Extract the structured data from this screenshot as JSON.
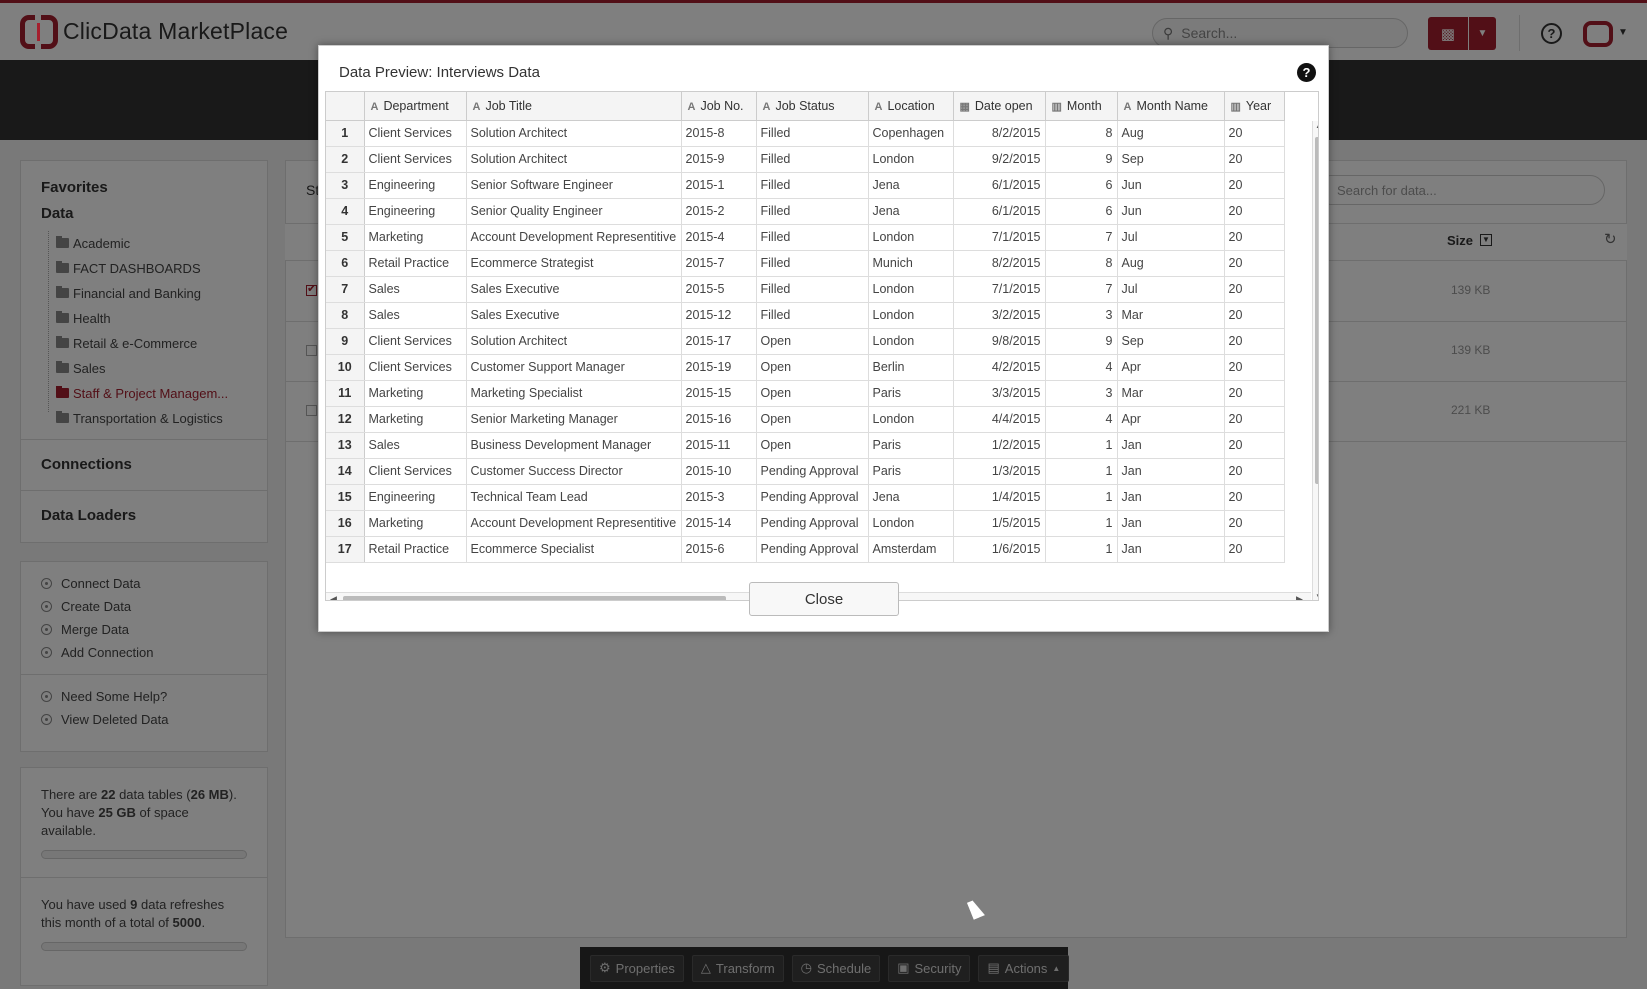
{
  "app": {
    "title": "ClicData MarketPlace",
    "search_placeholder": "Search..."
  },
  "sidebar": {
    "favorites": "Favorites",
    "data": "Data",
    "folders": [
      "Academic",
      "FACT DASHBOARDS",
      "Financial and Banking",
      "Health",
      "Retail & e-Commerce",
      "Sales",
      "Staff & Project Managem...",
      "Transportation & Logistics"
    ],
    "active_folder_index": 6,
    "connections": "Connections",
    "data_loaders": "Data Loaders",
    "actions": [
      "Connect Data",
      "Create Data",
      "Merge Data",
      "Add Connection"
    ],
    "help": [
      "Need Some Help?",
      "View Deleted Data"
    ],
    "storage": {
      "t1": "There are ",
      "tables": "22",
      "t2": " data tables (",
      "size": "26 MB",
      "t3": "). You have ",
      "space": "25 GB",
      "t4": " of space available."
    },
    "refreshes": {
      "t1": "You have used ",
      "used": "9",
      "t2": " data refreshes this month of a total of ",
      "total": "5000",
      "t3": "."
    }
  },
  "main": {
    "label": "St",
    "search_placeholder": "Search for data...",
    "size_header": "Size",
    "rows": [
      {
        "size": "139 KB",
        "checked": true
      },
      {
        "size": "139 KB",
        "checked": false
      },
      {
        "size": "221 KB",
        "checked": false
      }
    ]
  },
  "toolbar": {
    "properties": "Properties",
    "transform": "Transform",
    "schedule": "Schedule",
    "security": "Security",
    "actions": "Actions"
  },
  "modal": {
    "title": "Data Preview: Interviews Data",
    "close": "Close",
    "columns": [
      {
        "name": "Department",
        "type": "A"
      },
      {
        "name": "Job Title",
        "type": "A"
      },
      {
        "name": "Job No.",
        "type": "A"
      },
      {
        "name": "Job Status",
        "type": "A"
      },
      {
        "name": "Location",
        "type": "A"
      },
      {
        "name": "Date open",
        "type": "date"
      },
      {
        "name": "Month",
        "type": "num"
      },
      {
        "name": "Month Name",
        "type": "A"
      },
      {
        "name": "Year",
        "type": "num"
      }
    ],
    "rows": [
      [
        "1",
        "Client Services",
        "Solution Architect",
        "2015-8",
        "Filled",
        "Copenhagen",
        "8/2/2015",
        "8",
        "Aug",
        "20"
      ],
      [
        "2",
        "Client Services",
        "Solution Architect",
        "2015-9",
        "Filled",
        "London",
        "9/2/2015",
        "9",
        "Sep",
        "20"
      ],
      [
        "3",
        "Engineering",
        "Senior Software Engineer",
        "2015-1",
        "Filled",
        "Jena",
        "6/1/2015",
        "6",
        "Jun",
        "20"
      ],
      [
        "4",
        "Engineering",
        "Senior Quality Engineer",
        "2015-2",
        "Filled",
        "Jena",
        "6/1/2015",
        "6",
        "Jun",
        "20"
      ],
      [
        "5",
        "Marketing",
        "Account Development Representitive",
        "2015-4",
        "Filled",
        "London",
        "7/1/2015",
        "7",
        "Jul",
        "20"
      ],
      [
        "6",
        "Retail Practice",
        "Ecommerce Strategist",
        "2015-7",
        "Filled",
        "Munich",
        "8/2/2015",
        "8",
        "Aug",
        "20"
      ],
      [
        "7",
        "Sales",
        "Sales Executive",
        "2015-5",
        "Filled",
        "London",
        "7/1/2015",
        "7",
        "Jul",
        "20"
      ],
      [
        "8",
        "Sales",
        "Sales Executive",
        "2015-12",
        "Filled",
        "London",
        "3/2/2015",
        "3",
        "Mar",
        "20"
      ],
      [
        "9",
        "Client Services",
        "Solution Architect",
        "2015-17",
        "Open",
        "London",
        "9/8/2015",
        "9",
        "Sep",
        "20"
      ],
      [
        "10",
        "Client Services",
        "Customer Support Manager",
        "2015-19",
        "Open",
        "Berlin",
        "4/2/2015",
        "4",
        "Apr",
        "20"
      ],
      [
        "11",
        "Marketing",
        "Marketing Specialist",
        "2015-15",
        "Open",
        "Paris",
        "3/3/2015",
        "3",
        "Mar",
        "20"
      ],
      [
        "12",
        "Marketing",
        "Senior Marketing Manager",
        "2015-16",
        "Open",
        "London",
        "4/4/2015",
        "4",
        "Apr",
        "20"
      ],
      [
        "13",
        "Sales",
        "Business Development Manager",
        "2015-11",
        "Open",
        "Paris",
        "1/2/2015",
        "1",
        "Jan",
        "20"
      ],
      [
        "14",
        "Client Services",
        "Customer Success Director",
        "2015-10",
        "Pending Approval",
        "Paris",
        "1/3/2015",
        "1",
        "Jan",
        "20"
      ],
      [
        "15",
        "Engineering",
        "Technical Team Lead",
        "2015-3",
        "Pending Approval",
        "Jena",
        "1/4/2015",
        "1",
        "Jan",
        "20"
      ],
      [
        "16",
        "Marketing",
        "Account Development Representitive",
        "2015-14",
        "Pending Approval",
        "London",
        "1/5/2015",
        "1",
        "Jan",
        "20"
      ],
      [
        "17",
        "Retail Practice",
        "Ecommerce Specialist",
        "2015-6",
        "Pending Approval",
        "Amsterdam",
        "1/6/2015",
        "1",
        "Jan",
        "20"
      ]
    ]
  },
  "colors": {
    "brand": "#a51f2e",
    "dark": "#333333"
  }
}
